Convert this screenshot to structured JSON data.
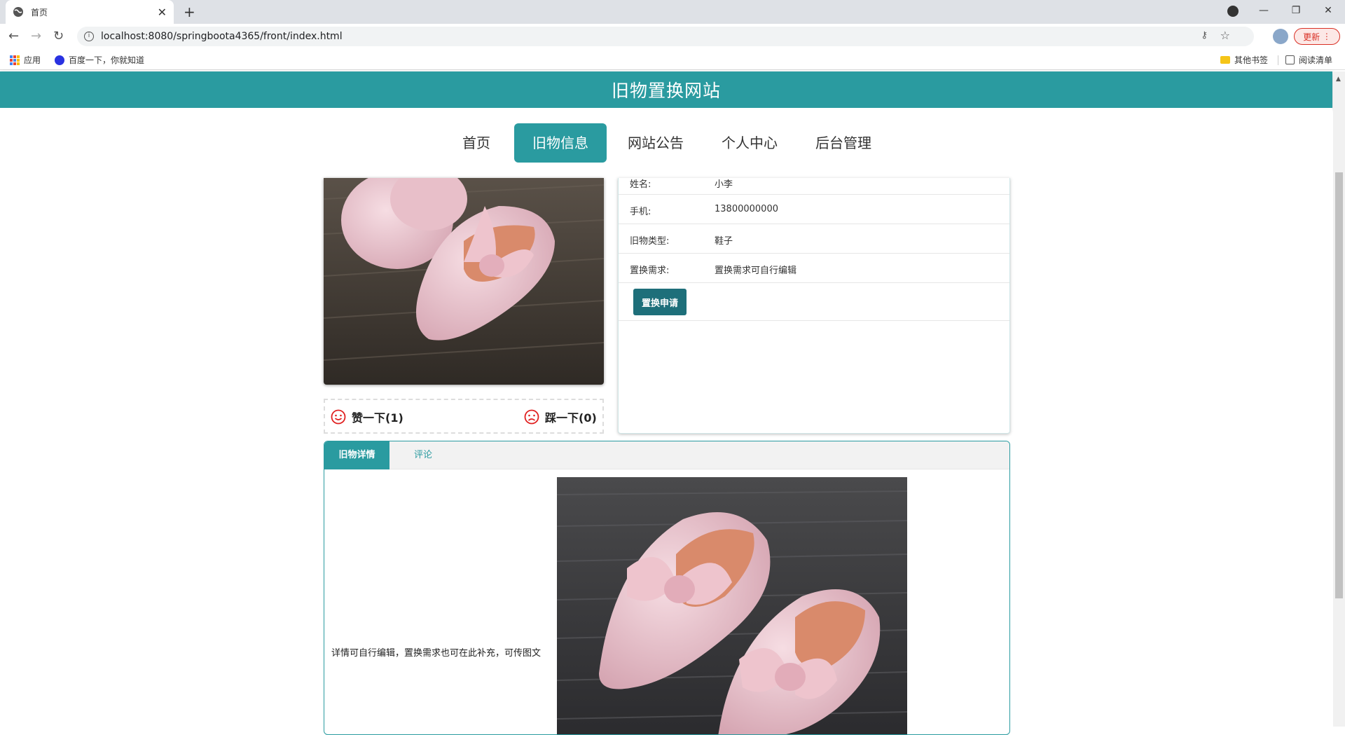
{
  "browser": {
    "tab_title": "首页",
    "url": "localhost:8080/springboota4365/front/index.html",
    "update_label": "更新",
    "bookmarks": [
      "应用",
      "百度一下，你就知道"
    ],
    "bookmarks_right": [
      "其他书签",
      "阅读清单"
    ]
  },
  "site": {
    "title": "旧物置换网站",
    "nav": [
      "首页",
      "旧物信息",
      "网站公告",
      "个人中心",
      "后台管理"
    ],
    "active_nav": "旧物信息"
  },
  "info": {
    "rows": [
      {
        "label": "姓名:",
        "value": "小李"
      },
      {
        "label": "手机:",
        "value": "13800000000"
      },
      {
        "label": "旧物类型:",
        "value": "鞋子"
      },
      {
        "label": "置换需求:",
        "value": "置换需求可自行编辑"
      }
    ],
    "apply_label": "置换申请"
  },
  "votes": {
    "like_label": "赞一下(1)",
    "dislike_label": "踩一下(0)"
  },
  "detail": {
    "tabs": [
      "旧物详情",
      "评论"
    ],
    "text": "详情可自行编辑，置换需求也可在此补充，可传图文"
  },
  "colors": {
    "brand": "#2a9ba0",
    "button": "#1e6f7a"
  }
}
